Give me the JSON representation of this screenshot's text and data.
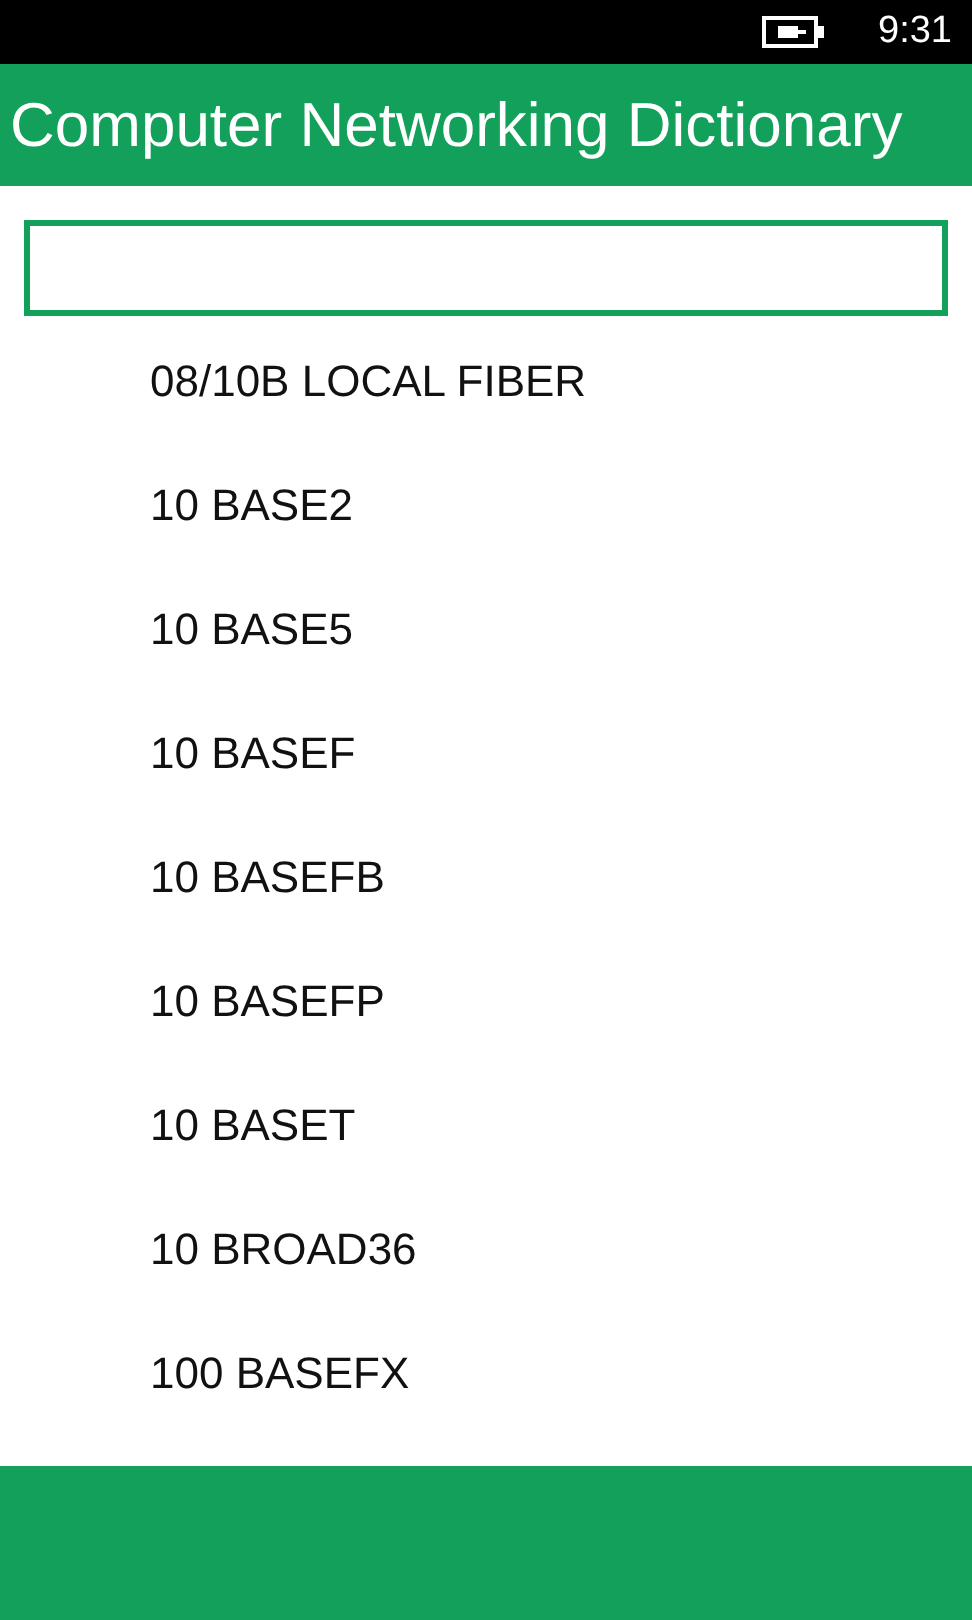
{
  "status_bar": {
    "time": "9:31"
  },
  "header": {
    "title": "Computer Networking Dictionary"
  },
  "terms": [
    "08/10B LOCAL FIBER",
    "10 BASE2",
    "10 BASE5",
    "10 BASEF",
    "10 BASEFB",
    "10 BASEFP",
    "10 BASET",
    "10 BROAD36",
    "100 BASEFX"
  ]
}
